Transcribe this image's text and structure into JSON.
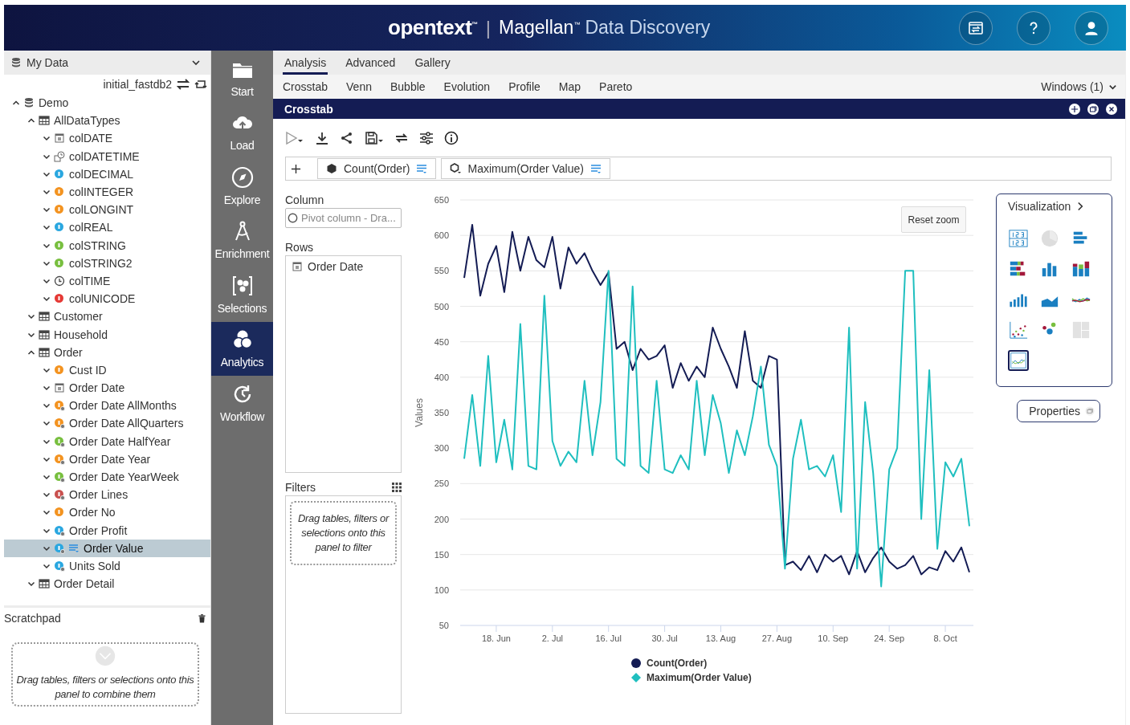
{
  "header": {
    "brand": "opentext$^{™}$",
    "separator": "|",
    "product": "Magellan$^{™}$",
    "product_sub": "Data Discovery"
  },
  "data_panel": {
    "title": "My Data",
    "source": "initial_fastdb2",
    "tree": [
      {
        "label": "Demo",
        "kind": "database",
        "expanded": true,
        "selected": false,
        "in_use": false,
        "children": [
          {
            "label": "AllDataTypes",
            "kind": "table",
            "expanded": true,
            "selected": false,
            "in_use": false,
            "children": [
              {
                "label": "colDATE",
                "kind": "date",
                "expanded": false,
                "selected": false,
                "in_use": false
              },
              {
                "label": "colDATETIME",
                "kind": "datetime",
                "expanded": false,
                "selected": false,
                "in_use": false
              },
              {
                "label": "colDECIMAL",
                "kind": "decimal",
                "expanded": false,
                "selected": false,
                "in_use": false
              },
              {
                "label": "colINTEGER",
                "kind": "integer",
                "expanded": false,
                "selected": false,
                "in_use": false
              },
              {
                "label": "colLONGINT",
                "kind": "integer",
                "expanded": false,
                "selected": false,
                "in_use": false
              },
              {
                "label": "colREAL",
                "kind": "decimal",
                "expanded": false,
                "selected": false,
                "in_use": false
              },
              {
                "label": "colSTRING",
                "kind": "string",
                "expanded": false,
                "selected": false,
                "in_use": false
              },
              {
                "label": "colSTRING2",
                "kind": "string",
                "expanded": false,
                "selected": false,
                "in_use": false
              },
              {
                "label": "colTIME",
                "kind": "time",
                "expanded": false,
                "selected": false,
                "in_use": false
              },
              {
                "label": "colUNICODE",
                "kind": "unicode",
                "expanded": false,
                "selected": false,
                "in_use": false
              }
            ]
          },
          {
            "label": "Customer",
            "kind": "table",
            "expanded": false,
            "selected": false,
            "in_use": false
          },
          {
            "label": "Household",
            "kind": "table",
            "expanded": false,
            "selected": false,
            "in_use": false
          },
          {
            "label": "Order",
            "kind": "table",
            "expanded": true,
            "selected": false,
            "in_use": false,
            "children": [
              {
                "label": "Cust ID",
                "kind": "integer",
                "expanded": false,
                "selected": false,
                "in_use": false
              },
              {
                "label": "Order Date",
                "kind": "date",
                "expanded": false,
                "selected": false,
                "in_use": false
              },
              {
                "label": "Order Date AllMonths",
                "kind": "integer_derived",
                "expanded": false,
                "selected": false,
                "in_use": false
              },
              {
                "label": "Order Date AllQuarters",
                "kind": "integer_derived",
                "expanded": false,
                "selected": false,
                "in_use": false
              },
              {
                "label": "Order Date HalfYear",
                "kind": "string_derived",
                "expanded": false,
                "selected": false,
                "in_use": false
              },
              {
                "label": "Order Date Year",
                "kind": "integer_derived",
                "expanded": false,
                "selected": false,
                "in_use": false
              },
              {
                "label": "Order Date YearWeek",
                "kind": "string_derived",
                "expanded": false,
                "selected": false,
                "in_use": false
              },
              {
                "label": "Order Lines",
                "kind": "count_derived",
                "expanded": false,
                "selected": false,
                "in_use": false
              },
              {
                "label": "Order No",
                "kind": "integer",
                "expanded": false,
                "selected": false,
                "in_use": false
              },
              {
                "label": "Order Profit",
                "kind": "decimal_derived",
                "expanded": false,
                "selected": false,
                "in_use": false
              },
              {
                "label": "Order Value",
                "kind": "decimal_derived",
                "expanded": false,
                "selected": true,
                "in_use": true
              },
              {
                "label": "Units Sold",
                "kind": "decimal_derived",
                "expanded": false,
                "selected": false,
                "in_use": false
              }
            ]
          },
          {
            "label": "Order Detail",
            "kind": "table",
            "expanded": false,
            "selected": false,
            "in_use": false
          }
        ]
      }
    ]
  },
  "scratchpad": {
    "title": "Scratchpad",
    "hint": "Drag tables, filters or selections onto this panel to combine them"
  },
  "nav": [
    {
      "label": "Start",
      "kind": "folder",
      "selected": false
    },
    {
      "label": "Load",
      "kind": "cloud",
      "selected": false
    },
    {
      "label": "Explore",
      "kind": "compass",
      "selected": false
    },
    {
      "label": "Enrichment",
      "kind": "enrich",
      "selected": false
    },
    {
      "label": "Selections",
      "kind": "selections",
      "selected": false
    },
    {
      "label": "Analytics",
      "kind": "analytics",
      "selected": true
    },
    {
      "label": "Workflow",
      "kind": "workflow",
      "selected": false
    }
  ],
  "tabs": [
    {
      "label": "Analysis",
      "selected": true
    },
    {
      "label": "Advanced",
      "selected": false
    },
    {
      "label": "Gallery",
      "selected": false
    }
  ],
  "subtabs": [
    "Crosstab",
    "Venn",
    "Bubble",
    "Evolution",
    "Profile",
    "Map",
    "Pareto"
  ],
  "windows_menu": "Windows (1)",
  "window": {
    "title": "Crosstab",
    "measures": [
      {
        "label": "Count(Order)",
        "kind": "hexagon"
      },
      {
        "label": "Maximum(Order Value)",
        "kind": "calc"
      }
    ],
    "column_label": "Column",
    "column_placeholder": "Pivot column - Dra...",
    "rows_label": "Rows",
    "rows": [
      "Order Date"
    ],
    "filters_label": "Filters",
    "filters_hint": "Drag tables, filters or selections onto this panel to filter",
    "reset_zoom": "Reset zoom",
    "chart_data": {
      "type": "line",
      "grid": true,
      "legend": "bottom",
      "ylabel": "Values",
      "ylim": [
        50,
        650
      ],
      "yticks": [
        50,
        100,
        150,
        200,
        250,
        300,
        350,
        400,
        450,
        500,
        550,
        600,
        650
      ],
      "categories": [
        null,
        null,
        null,
        null,
        "18. Jun",
        null,
        null,
        null,
        null,
        null,
        null,
        "2. Jul",
        null,
        null,
        null,
        null,
        null,
        null,
        "16. Jul",
        null,
        null,
        null,
        null,
        null,
        null,
        "30. Jul",
        null,
        null,
        null,
        null,
        null,
        null,
        "13. Aug",
        null,
        null,
        null,
        null,
        null,
        null,
        "27. Aug",
        null,
        null,
        null,
        null,
        null,
        null,
        "10. Sep",
        null,
        null,
        null,
        null,
        null,
        null,
        "24. Sep",
        null,
        null,
        null,
        null,
        null,
        null,
        "8. Oct",
        null,
        null,
        null
      ],
      "series": [
        {
          "name": "Count(Order)",
          "color": "#141c54",
          "values": [
            540,
            615,
            515,
            560,
            585,
            520,
            605,
            550,
            598,
            565,
            555,
            598,
            525,
            583,
            560,
            575,
            550,
            530,
            548,
            440,
            450,
            410,
            440,
            425,
            430,
            445,
            385,
            420,
            395,
            415,
            400,
            470,
            440,
            415,
            385,
            465,
            395,
            385,
            430,
            425,
            135,
            140,
            128,
            148,
            125,
            150,
            140,
            148,
            122,
            155,
            125,
            145,
            160,
            140,
            130,
            135,
            148,
            122,
            132,
            128,
            155,
            140,
            160,
            125
          ]
        },
        {
          "name": "Maximum(Order Value)",
          "color": "#1fbfbf",
          "values": [
            285,
            375,
            275,
            430,
            280,
            340,
            270,
            475,
            275,
            270,
            515,
            310,
            275,
            295,
            280,
            395,
            290,
            365,
            550,
            285,
            275,
            528,
            275,
            265,
            395,
            270,
            265,
            290,
            270,
            395,
            290,
            375,
            335,
            265,
            325,
            290,
            345,
            415,
            305,
            275,
            130,
            285,
            340,
            270,
            275,
            260,
            290,
            210,
            470,
            130,
            365,
            265,
            105,
            270,
            300,
            550,
            550,
            200,
            410,
            158,
            280,
            260,
            285,
            190
          ]
        }
      ]
    }
  },
  "visualization": {
    "title": "Visualization",
    "types": [
      {
        "kind": "numbers",
        "selected": false,
        "disabled": false
      },
      {
        "kind": "pie",
        "selected": false,
        "disabled": true
      },
      {
        "kind": "hbar",
        "selected": false,
        "disabled": false
      },
      {
        "kind": "stacked_hbar",
        "selected": false,
        "disabled": false
      },
      {
        "kind": "column",
        "selected": false,
        "disabled": false
      },
      {
        "kind": "stacked_column",
        "selected": false,
        "disabled": false
      },
      {
        "kind": "rising_column",
        "selected": false,
        "disabled": false
      },
      {
        "kind": "area",
        "selected": false,
        "disabled": false
      },
      {
        "kind": "multiline",
        "selected": false,
        "disabled": false
      },
      {
        "kind": "scatter",
        "selected": false,
        "disabled": false
      },
      {
        "kind": "bubble",
        "selected": false,
        "disabled": false
      },
      {
        "kind": "treemap",
        "selected": false,
        "disabled": true
      },
      {
        "kind": "line",
        "selected": true,
        "disabled": false
      }
    ]
  },
  "properties_button": "Properties"
}
